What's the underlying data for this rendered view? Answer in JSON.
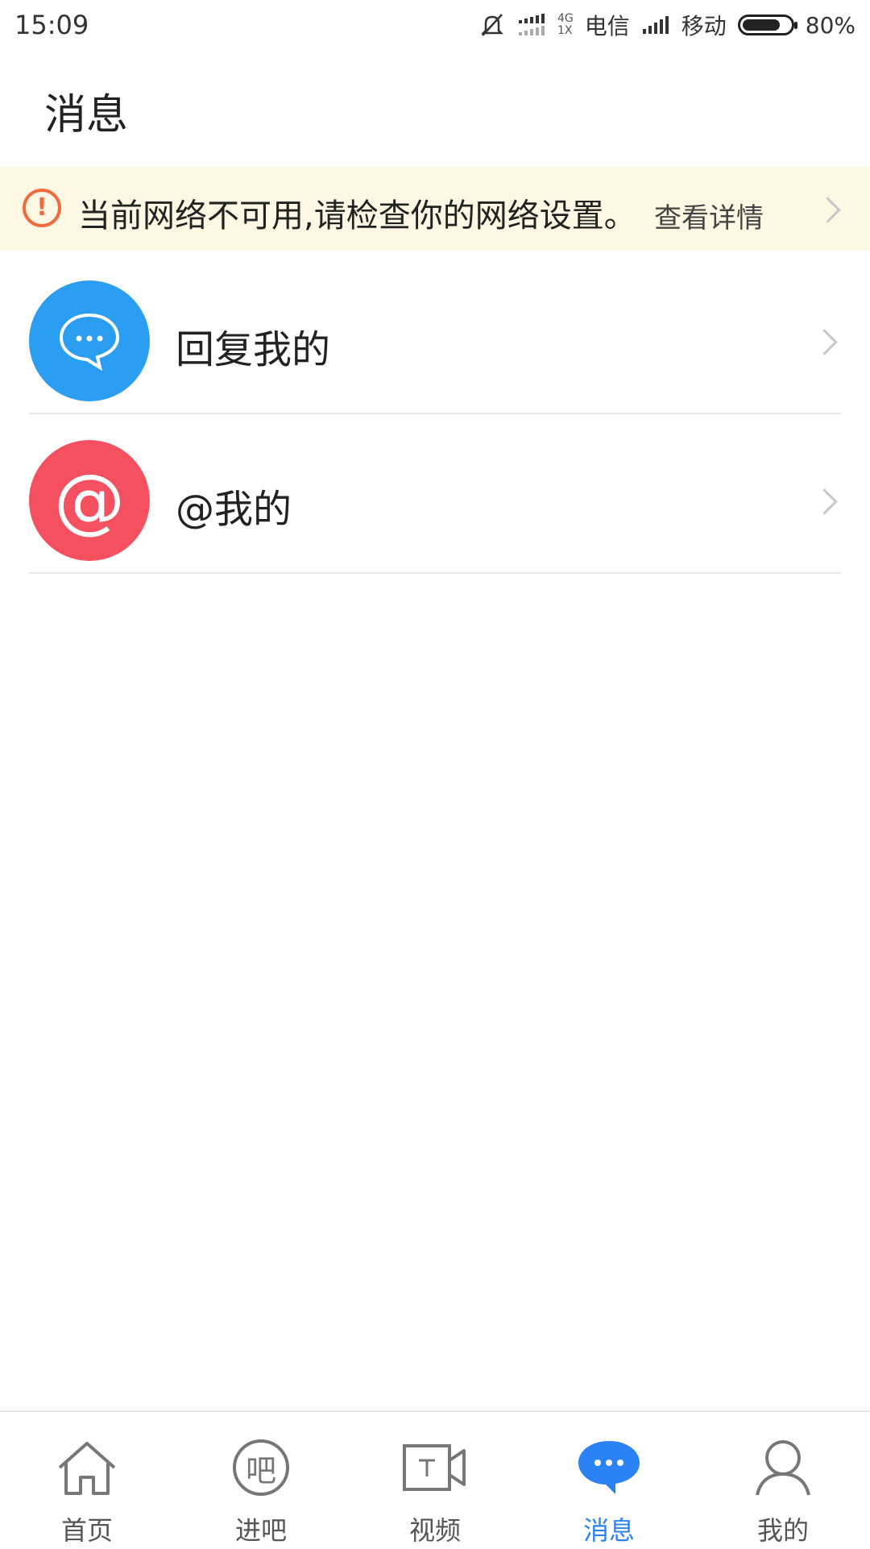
{
  "status_bar": {
    "time": "15:09",
    "net_small_top": "4G",
    "net_small_bottom": "1X",
    "carrier1": "电信",
    "carrier2": "移动",
    "battery_percent_text": "80%",
    "battery_level": 0.8,
    "icons": [
      "bell-muted-icon",
      "signal-icon",
      "signal-icon",
      "battery-icon"
    ]
  },
  "header": {
    "title": "消息"
  },
  "network_banner": {
    "message": "当前网络不可用,请检查你的网络设置。",
    "detail_link": "查看详情",
    "colors": {
      "background": "#fdf7e3",
      "warning": "#ef6a3d"
    }
  },
  "messages": {
    "items": [
      {
        "label": "回复我的",
        "icon": "chat-bubble-icon",
        "color": "#2b9ef2"
      },
      {
        "label": "@我的",
        "icon": "at-sign-icon",
        "color": "#f5505f"
      }
    ]
  },
  "bottom_nav": {
    "items": [
      {
        "label": "首页",
        "icon": "home-icon",
        "active": false
      },
      {
        "label": "进吧",
        "icon": "ba-icon",
        "icon_text": "吧",
        "active": false
      },
      {
        "label": "视频",
        "icon": "video-icon",
        "active": false
      },
      {
        "label": "消息",
        "icon": "message-icon",
        "active": true
      },
      {
        "label": "我的",
        "icon": "user-icon",
        "active": false
      }
    ],
    "active_color": "#2b82f5"
  }
}
